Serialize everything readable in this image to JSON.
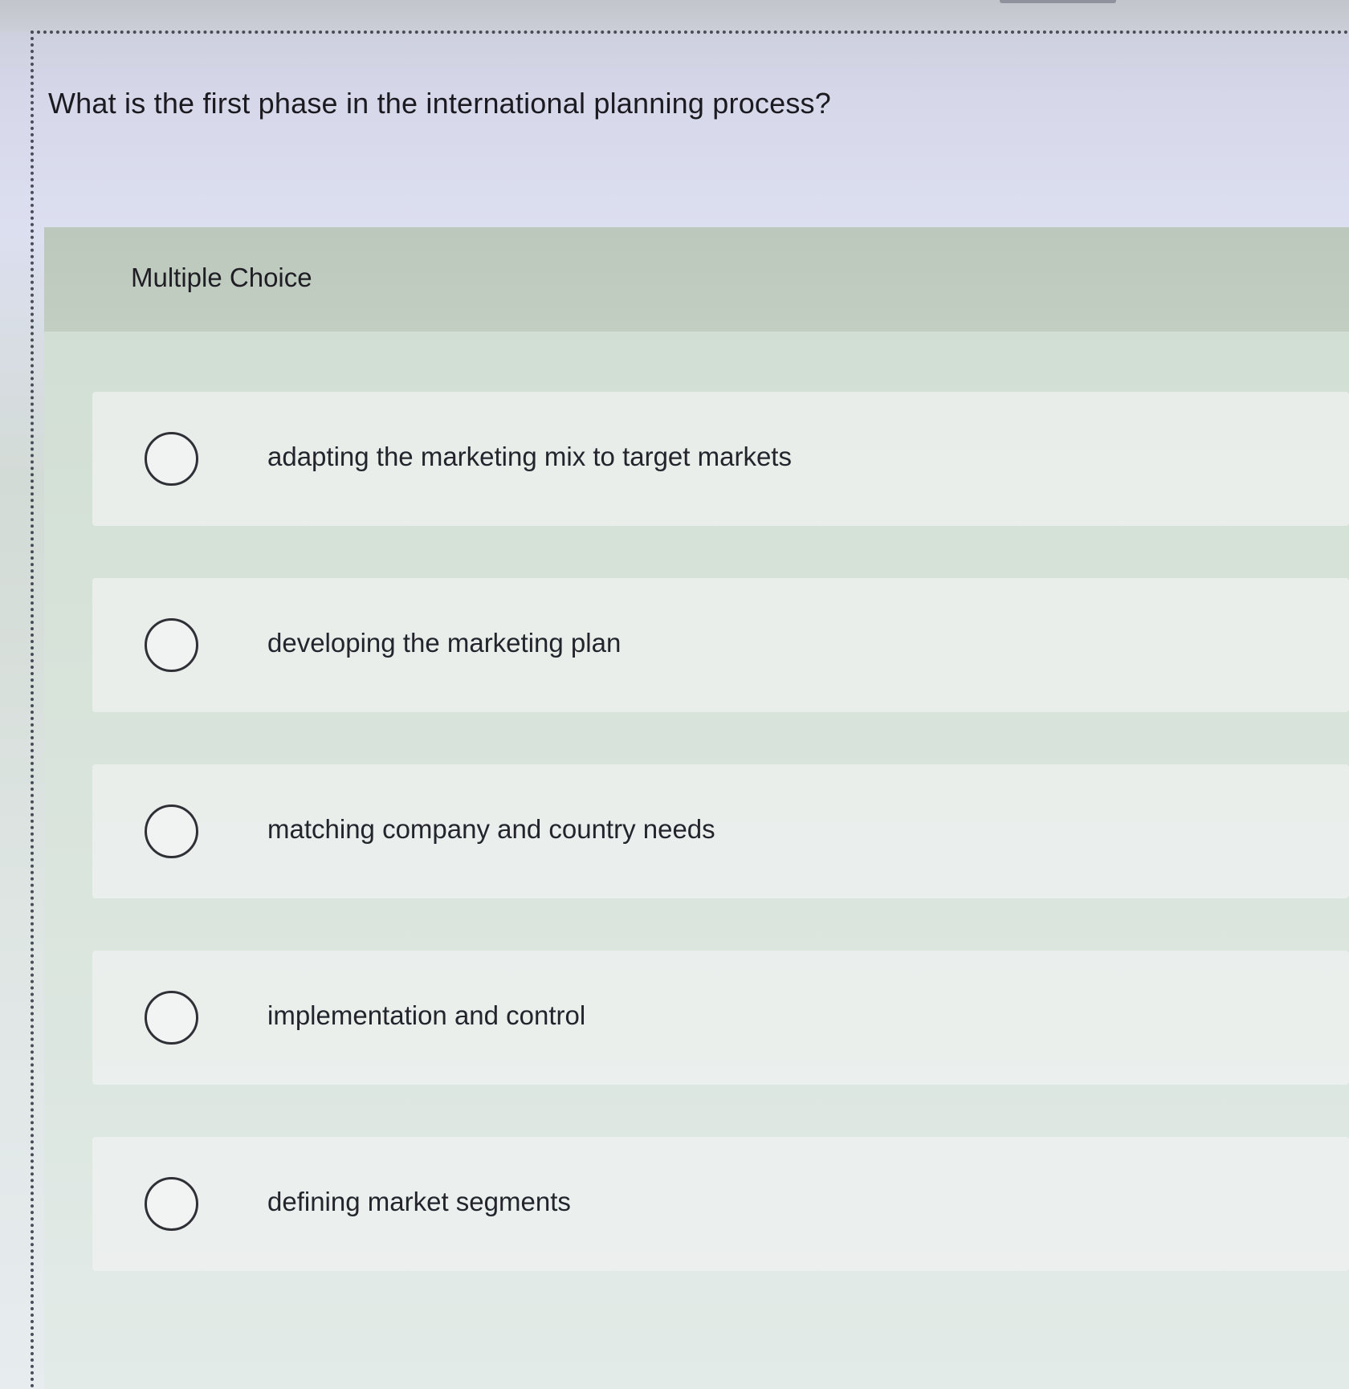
{
  "question": {
    "text": "What is the first phase in the international planning process?"
  },
  "panel": {
    "type_label": "Multiple Choice"
  },
  "options": [
    {
      "label": "adapting the marketing mix to target markets",
      "selected": false
    },
    {
      "label": "developing the marketing plan",
      "selected": false
    },
    {
      "label": "matching company and country needs",
      "selected": false
    },
    {
      "label": "implementation and control",
      "selected": false
    },
    {
      "label": "defining market segments",
      "selected": false
    }
  ]
}
